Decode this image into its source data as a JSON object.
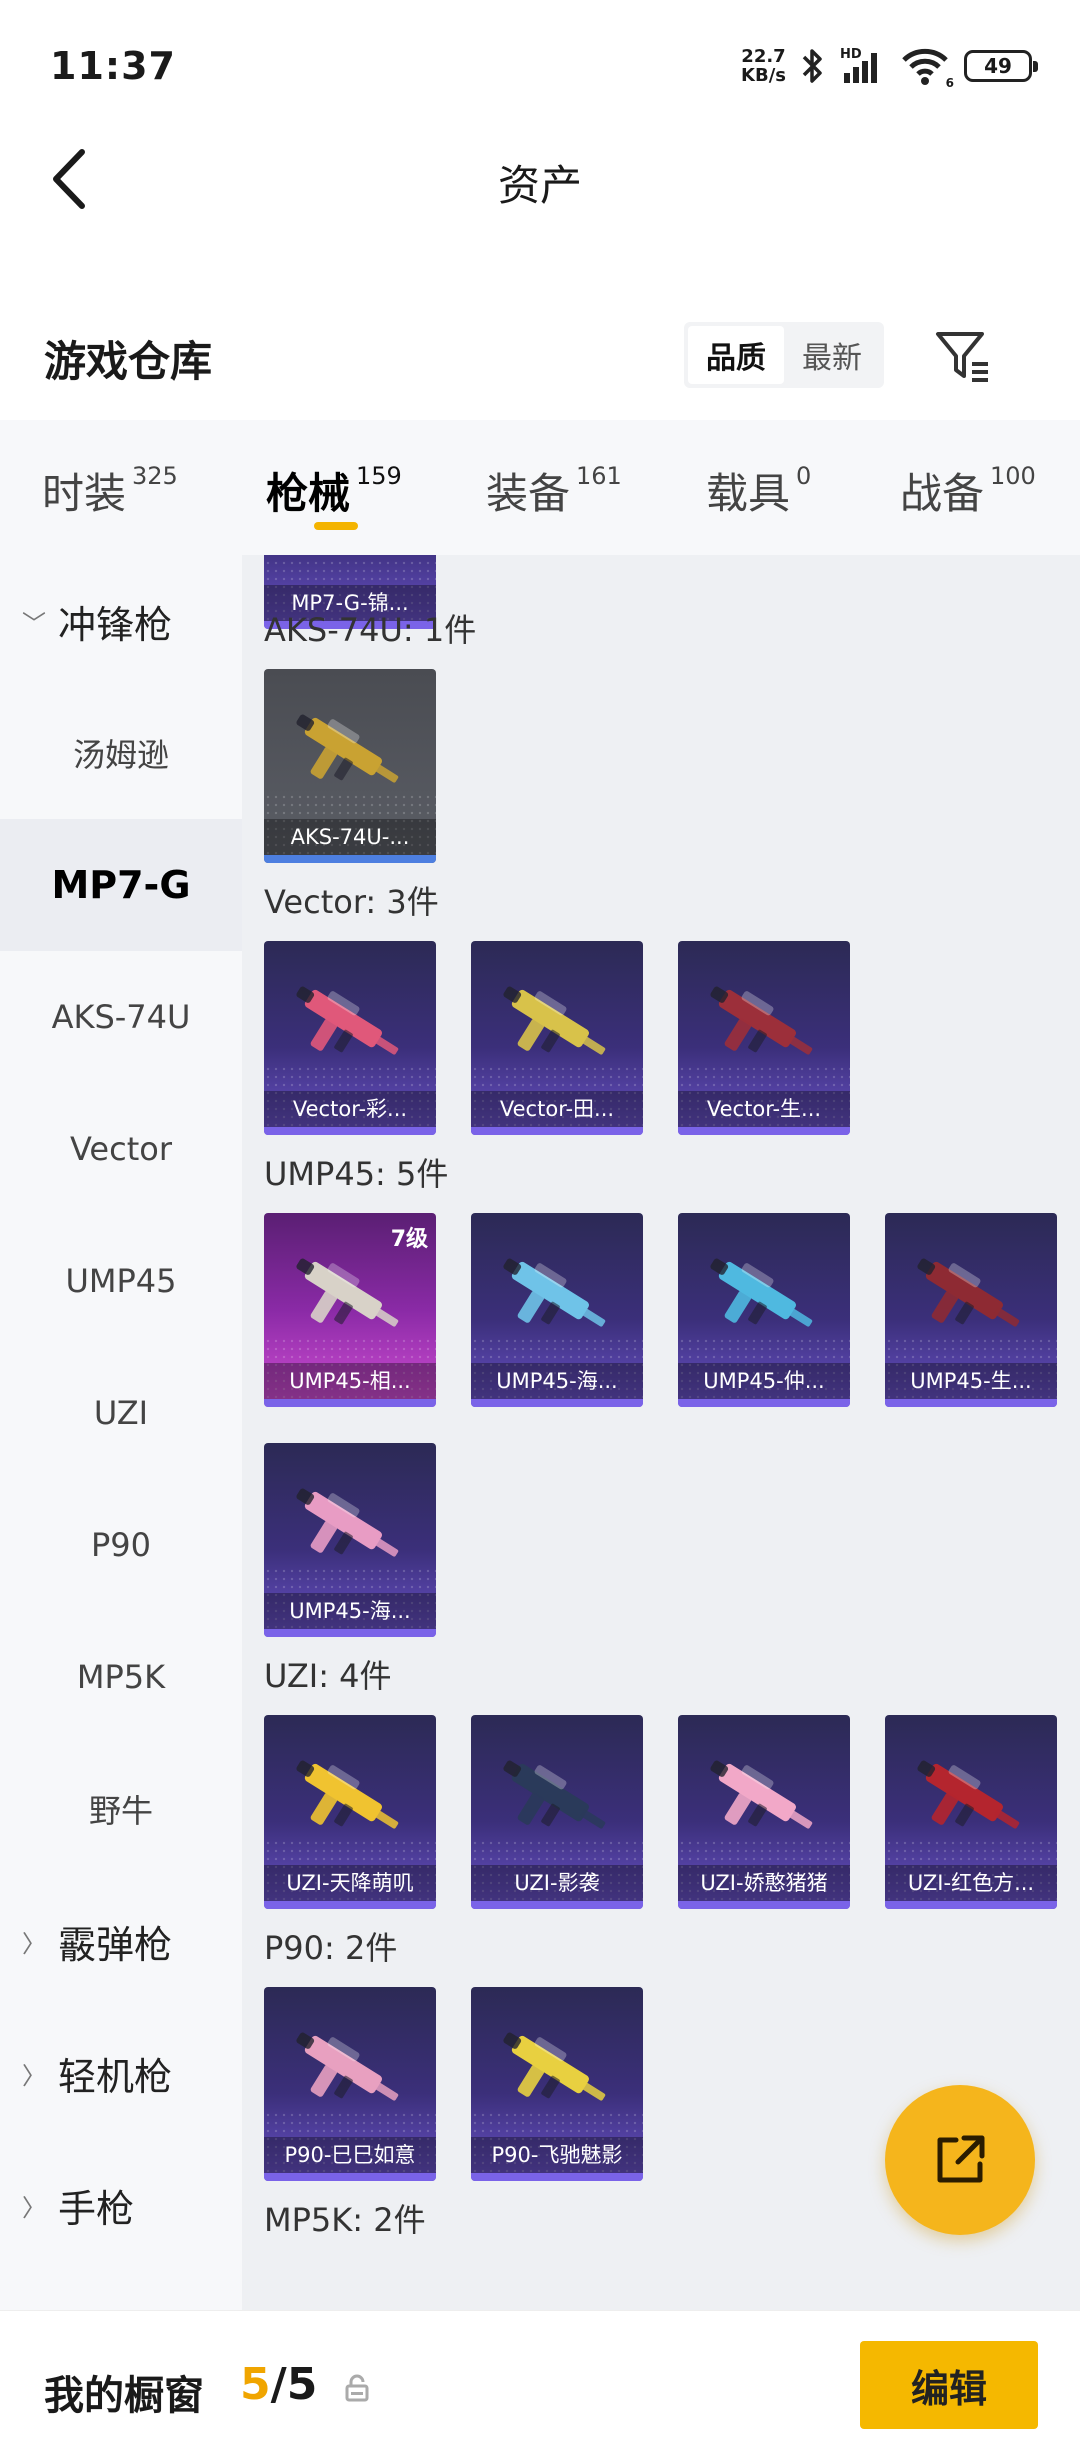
{
  "status": {
    "time": "11:37",
    "net_speed_value": "22.7",
    "net_speed_unit": "KB/s",
    "hd": "HD",
    "wifi_sub": "6",
    "battery": "49"
  },
  "header": {
    "title": "资产"
  },
  "warehouse": {
    "title": "游戏仓库",
    "sort": [
      "品质",
      "最新"
    ],
    "active_sort": "品质"
  },
  "tabs": [
    {
      "label": "时装",
      "count": "325"
    },
    {
      "label": "枪械",
      "count": "159",
      "active": true
    },
    {
      "label": "装备",
      "count": "161"
    },
    {
      "label": "载具",
      "count": "0"
    },
    {
      "label": "战备",
      "count": "100"
    }
  ],
  "sidebar": [
    {
      "label": "冲锋枪",
      "type": "group",
      "expanded": true
    },
    {
      "label": "汤姆逊"
    },
    {
      "label": "MP7-G",
      "selected": true
    },
    {
      "label": "AKS-74U"
    },
    {
      "label": "Vector"
    },
    {
      "label": "UMP45"
    },
    {
      "label": "UZI"
    },
    {
      "label": "P90"
    },
    {
      "label": "MP5K"
    },
    {
      "label": "野牛"
    },
    {
      "label": "霰弹枪",
      "type": "group"
    },
    {
      "label": "轻机枪",
      "type": "group"
    },
    {
      "label": "手枪",
      "type": "group"
    }
  ],
  "partial_card": {
    "name": "MP7-G-锦..."
  },
  "sections": [
    {
      "title": "AKS-74U: 1件",
      "items": [
        {
          "name": "AKS-74U-...",
          "style": "gray",
          "color": "#c9a232"
        }
      ]
    },
    {
      "title": "Vector: 3件",
      "items": [
        {
          "name": "Vector-彩...",
          "color": "#e0587a"
        },
        {
          "name": "Vector-田...",
          "color": "#d8c24a"
        },
        {
          "name": "Vector-生...",
          "color": "#9c2f3a"
        }
      ]
    },
    {
      "title": "UMP45: 5件",
      "items": [
        {
          "name": "UMP45-相...",
          "style": "pink",
          "level": "7级",
          "color": "#d8d2c8"
        },
        {
          "name": "UMP45-海...",
          "color": "#6fc3e8"
        },
        {
          "name": "UMP45-仲...",
          "color": "#4fb9e0"
        },
        {
          "name": "UMP45-生...",
          "color": "#8e2a33"
        },
        {
          "name": "UMP45-海...",
          "color": "#e89cc4"
        }
      ]
    },
    {
      "title": "UZI: 4件",
      "items": [
        {
          "name": "UZI-天降萌叽",
          "color": "#f0c330"
        },
        {
          "name": "UZI-影袭",
          "color": "#2a3a5a"
        },
        {
          "name": "UZI-娇憨猪猪",
          "color": "#f2a8c8"
        },
        {
          "name": "UZI-红色方...",
          "color": "#b4252e"
        }
      ]
    },
    {
      "title": "P90: 2件",
      "items": [
        {
          "name": "P90-巳巳如意",
          "color": "#e8a0c0"
        },
        {
          "name": "P90-飞驰魅影",
          "color": "#e8d040"
        }
      ]
    },
    {
      "title": "MP5K: 2件",
      "items": []
    }
  ],
  "bottom": {
    "title": "我的橱窗",
    "count_current": "5",
    "count_sep": "/",
    "count_total": "5",
    "edit_label": "编辑"
  }
}
